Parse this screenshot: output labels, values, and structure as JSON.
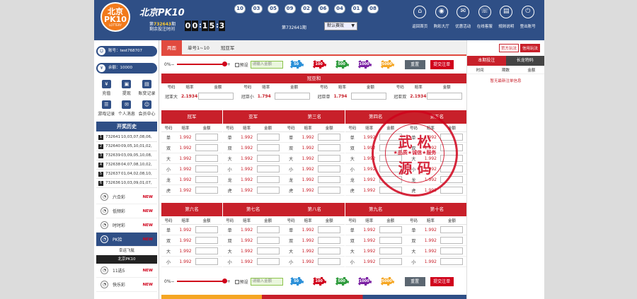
{
  "header": {
    "logo": {
      "line1": "北京",
      "line2": "PK10",
      "line3": "LOTTERY"
    },
    "title": "北京PK10",
    "balls": [
      "10",
      "03",
      "05",
      "09",
      "02",
      "06",
      "04",
      "01",
      "08"
    ],
    "period_prefix": "第",
    "period_num": "732643",
    "period_suffix": "期",
    "remaining_label": "剩余投注时间",
    "countdown": [
      "0",
      "0",
      "1",
      "5",
      "3"
    ],
    "current_period": "第732641期",
    "mode": "默认赛效",
    "nav": [
      {
        "label": "返回首页",
        "icon": "⌂"
      },
      {
        "label": "购彩大厅",
        "icon": "◉"
      },
      {
        "label": "优惠活动",
        "icon": "✉"
      },
      {
        "label": "在线客服",
        "icon": "☏"
      },
      {
        "label": "规则说明",
        "icon": "▤"
      },
      {
        "label": "登出账号",
        "icon": "⏻"
      }
    ]
  },
  "sidebar": {
    "account": "账号：test768707",
    "balance": "余额：10000",
    "quick": [
      {
        "label": "充值",
        "icon": "¥"
      },
      {
        "label": "提现",
        "icon": "▣"
      },
      {
        "label": "账变记录",
        "icon": "▤"
      },
      {
        "label": "游戏记录",
        "icon": "☰"
      },
      {
        "label": "个人消息",
        "icon": "✉"
      },
      {
        "label": "会员中心",
        "icon": "☺"
      }
    ],
    "history_title": "开奖历史",
    "history": [
      {
        "idx": "1",
        "period": "732641",
        "nums": "10,03,07,08,06,"
      },
      {
        "idx": "2",
        "period": "732640",
        "nums": "09,05,10,01,02,"
      },
      {
        "idx": "3",
        "period": "732639",
        "nums": "03,09,05,10,08,"
      },
      {
        "idx": "4",
        "period": "732638",
        "nums": "04,07,08,10,02,"
      },
      {
        "idx": "5",
        "period": "732637",
        "nums": "01,04,02,08,10,"
      },
      {
        "idx": "6",
        "period": "732636",
        "nums": "10,03,09,01,07,"
      }
    ],
    "games": [
      {
        "name": "六合彩",
        "badge": "NEW"
      },
      {
        "name": "低频彩",
        "badge": "NEW"
      },
      {
        "name": "时时彩",
        "badge": "NEW"
      },
      {
        "name": "PK拾",
        "badge": "NEW"
      }
    ],
    "subgames": [
      "幸运飞艇",
      "北京PK10"
    ],
    "games2": [
      {
        "name": "11选5",
        "badge": "NEW"
      },
      {
        "name": "快乐彩",
        "badge": "NEW"
      }
    ]
  },
  "main": {
    "tabs": [
      "两面",
      "单号1~10",
      "冠亚军"
    ],
    "chipbar": {
      "pct": "0%",
      "preset": "预设",
      "amount_placeholder": "请输入金额",
      "chips": [
        "50",
        "100",
        "500",
        "1000",
        "5000"
      ],
      "reset": "重置",
      "submit": "提交注单"
    },
    "gy_title": "冠亚和",
    "head": {
      "num": "号码",
      "odds": "赔率",
      "amount": "金额"
    },
    "gy_cells": [
      {
        "name": "冠亚大",
        "odds": "2.1934"
      },
      {
        "name": "冠亚小",
        "odds": "1.794"
      },
      {
        "name": "冠亚单",
        "odds": "1.794"
      },
      {
        "name": "冠亚双",
        "odds": "2.1934"
      }
    ],
    "ranks1": [
      {
        "title": "冠军",
        "rows": [
          [
            "单",
            "1.992"
          ],
          [
            "双",
            "1.992"
          ],
          [
            "大",
            "1.992"
          ],
          [
            "小",
            "1.992"
          ],
          [
            "龙",
            "1.992"
          ],
          [
            "虎",
            "1.992"
          ]
        ]
      },
      {
        "title": "亚军",
        "rows": [
          [
            "单",
            "1.992"
          ],
          [
            "双",
            "1.992"
          ],
          [
            "大",
            "1.992"
          ],
          [
            "小",
            "1.992"
          ],
          [
            "龙",
            "1.992"
          ],
          [
            "虎",
            "1.992"
          ]
        ]
      },
      {
        "title": "第三名",
        "rows": [
          [
            "单",
            "1.992"
          ],
          [
            "双",
            "1.992"
          ],
          [
            "大",
            "1.992"
          ],
          [
            "小",
            "1.992"
          ],
          [
            "龙",
            "1.992"
          ],
          [
            "虎",
            "1.992"
          ]
        ]
      },
      {
        "title": "第四名",
        "rows": [
          [
            "单",
            "1.992"
          ],
          [
            "双",
            "1.992"
          ],
          [
            "大",
            "1.992"
          ],
          [
            "小",
            "1.992"
          ],
          [
            "龙",
            "1.992"
          ],
          [
            "虎",
            "1.992"
          ]
        ]
      },
      {
        "title": "第五名",
        "rows": [
          [
            "单",
            "1.992"
          ],
          [
            "双",
            "1.992"
          ],
          [
            "大",
            "1.992"
          ],
          [
            "小",
            "1.992"
          ],
          [
            "龙",
            "1.992"
          ],
          [
            "虎",
            "1.992"
          ]
        ]
      }
    ],
    "ranks2": [
      {
        "title": "第六名",
        "rows": [
          [
            "单",
            "1.992"
          ],
          [
            "双",
            "1.992"
          ],
          [
            "大",
            "1.992"
          ],
          [
            "小",
            "1.992"
          ]
        ]
      },
      {
        "title": "第七名",
        "rows": [
          [
            "单",
            "1.992"
          ],
          [
            "双",
            "1.992"
          ],
          [
            "大",
            "1.992"
          ],
          [
            "小",
            "1.992"
          ]
        ]
      },
      {
        "title": "第八名",
        "rows": [
          [
            "单",
            "1.992"
          ],
          [
            "双",
            "1.992"
          ],
          [
            "大",
            "1.992"
          ],
          [
            "小",
            "1.992"
          ]
        ]
      },
      {
        "title": "第九名",
        "rows": [
          [
            "单",
            "1.992"
          ],
          [
            "双",
            "1.992"
          ],
          [
            "大",
            "1.992"
          ],
          [
            "小",
            "1.992"
          ]
        ]
      },
      {
        "title": "第十名",
        "rows": [
          [
            "单",
            "1.992"
          ],
          [
            "双",
            "1.992"
          ],
          [
            "大",
            "1.992"
          ],
          [
            "小",
            "1.992"
          ]
        ]
      }
    ]
  },
  "rpanel": {
    "modes": [
      "官方玩法",
      "信用玩法"
    ],
    "tabs": [
      "本期投注",
      "长龙特码"
    ],
    "head": [
      "时间",
      "期数",
      "金额"
    ],
    "empty": "暂无最新注单信息"
  },
  "watermark": {
    "t1": "武 松",
    "t2": "★品质★诚信★服务",
    "t3": "源 码"
  },
  "colors": {
    "brand": "#2f4f86",
    "accent": "#c8202a"
  }
}
